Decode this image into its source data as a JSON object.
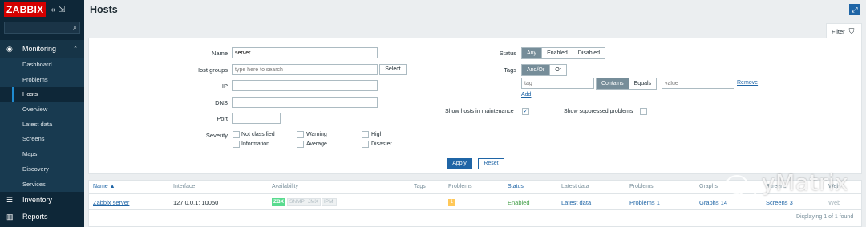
{
  "app": {
    "logo": "ZABBIX",
    "collapse_icon": "«",
    "kiosk_icon": "⇲"
  },
  "sidebar": {
    "sections": [
      {
        "label": "Monitoring",
        "icon": "eye-icon",
        "expanded": true
      },
      {
        "label": "Inventory",
        "icon": "list-icon"
      },
      {
        "label": "Reports",
        "icon": "bar-chart-icon"
      }
    ],
    "monitoring_items": [
      "Dashboard",
      "Problems",
      "Hosts",
      "Overview",
      "Latest data",
      "Screens",
      "Maps",
      "Discovery",
      "Services"
    ],
    "selected": "Hosts"
  },
  "header": {
    "title": "Hosts"
  },
  "filter": {
    "tab_label": "Filter",
    "name_label": "Name",
    "name_value": "server",
    "host_groups_label": "Host groups",
    "host_groups_placeholder": "type here to search",
    "select_label": "Select",
    "ip_label": "IP",
    "dns_label": "DNS",
    "port_label": "Port",
    "severity_label": "Severity",
    "severities": [
      "Not classified",
      "Warning",
      "High",
      "Information",
      "Average",
      "Disaster"
    ],
    "status_label": "Status",
    "status_options": [
      "Any",
      "Enabled",
      "Disabled"
    ],
    "status_selected": "Any",
    "tags_label": "Tags",
    "tags_options": [
      "And/Or",
      "Or"
    ],
    "tags_selected": "And/Or",
    "tag_placeholder": "tag",
    "tag_ops": [
      "Contains",
      "Equals"
    ],
    "tag_op_selected": "Contains",
    "value_placeholder": "value",
    "remove_label": "Remove",
    "add_label": "Add",
    "maintenance_label": "Show hosts in maintenance",
    "maintenance_checked": true,
    "suppressed_label": "Show suppressed problems",
    "suppressed_checked": false,
    "apply_label": "Apply",
    "reset_label": "Reset"
  },
  "table": {
    "columns": [
      "Name ▲",
      "Interface",
      "Availability",
      "Tags",
      "Problems",
      "Status",
      "Latest data",
      "Problems",
      "Graphs",
      "Screens",
      "Web"
    ],
    "rows": [
      {
        "name": "Zabbix server",
        "interface": "127.0.0.1: 10050",
        "availability": [
          "ZBX",
          "SNMP",
          "JMX",
          "IPMI"
        ],
        "problems_count": "1",
        "status": "Enabled",
        "latest_data": "Latest data",
        "problems": "Problems 1",
        "graphs": "Graphs 14",
        "screens": "Screens 3",
        "web": "Web"
      }
    ],
    "footer": "Displaying 1 of 1 found"
  },
  "watermark": {
    "text": "yMatrix"
  },
  "colors": {
    "accent": "#1f65a6",
    "sidebar": "#0e2738",
    "logo": "#d40000",
    "enabled": "#429e47",
    "zbx": "#59db8f",
    "problem": "#ffc859"
  }
}
